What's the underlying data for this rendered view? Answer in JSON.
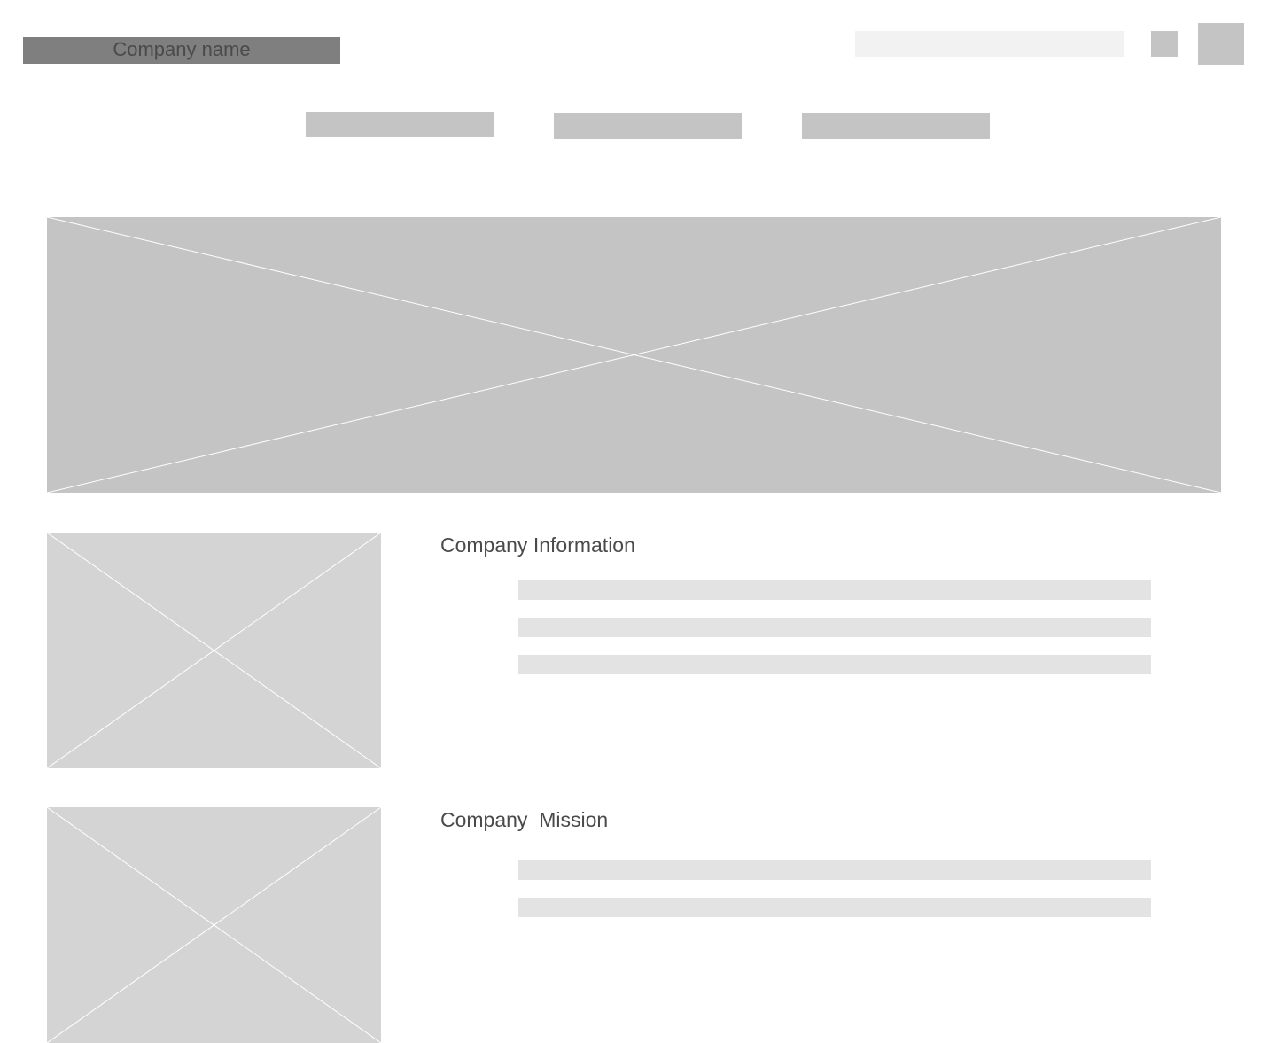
{
  "header": {
    "company_name": "Company name",
    "search": {
      "value": "",
      "placeholder": ""
    }
  },
  "icons": {
    "small_square": "square-icon",
    "large_square": "profile-icon"
  },
  "colors": {
    "logo_bg": "#7f7f7f",
    "placeholder_dark": "#c4c4c4",
    "placeholder_light": "#d4d4d4",
    "text_line": "#e3e3e3",
    "search_bg": "#f2f2f2",
    "text": "#4a4a4a"
  },
  "sections": [
    {
      "title": "Company Information"
    },
    {
      "title": "Company  Mission"
    }
  ]
}
